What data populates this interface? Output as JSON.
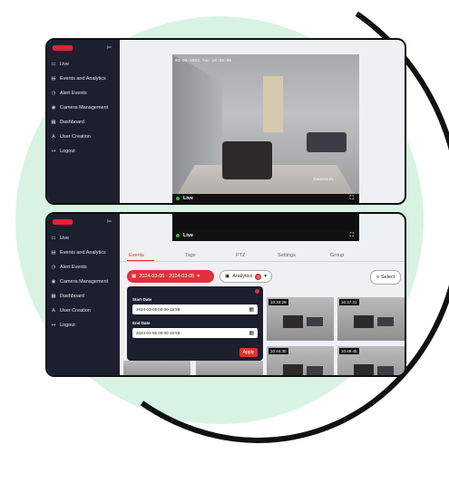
{
  "sidebar": {
    "items": [
      {
        "icon": "live-icon",
        "glyph": "▭",
        "label": "Live"
      },
      {
        "icon": "events-icon",
        "glyph": "▤",
        "label": "Events and Analytics"
      },
      {
        "icon": "alert-icon",
        "glyph": "◷",
        "label": "Alert Events"
      },
      {
        "icon": "camera-icon",
        "glyph": "◉",
        "label": "Camera Management"
      },
      {
        "icon": "dashboard-icon",
        "glyph": "▦",
        "label": "Dashboard"
      },
      {
        "icon": "user-icon",
        "glyph": "A",
        "label": "User Creation"
      },
      {
        "icon": "logout-icon",
        "glyph": "↦",
        "label": "Logout"
      }
    ]
  },
  "video": {
    "timestamp": "03-05-2024 Tue 20:58:09",
    "camera_label": "Camera 01",
    "live_label": "Live"
  },
  "events": {
    "tabs": [
      "Events",
      "Tags",
      "PTZ",
      "Settings",
      "Group"
    ],
    "active_tab": "Events",
    "date_range": "2024-03-05 - 2024-03-05",
    "analytics_label": "Analytics",
    "analytics_count": "0",
    "select_label": "Select",
    "popover": {
      "start_label": "Start Date",
      "start_value": "2024-03-05   00:00-15:59",
      "end_label": "End Date",
      "end_value": "2024-03-05   00:00-15:59",
      "apply_label": "Apply"
    },
    "thumbnails": [
      "10:33:29",
      "10:37:31",
      "10:44:30",
      "10:49:45"
    ]
  },
  "colors": {
    "accent": "#e0303c",
    "sidebar": "#1c1f2e",
    "live": "#27c04a",
    "background_circle": "#d8f3e4"
  }
}
